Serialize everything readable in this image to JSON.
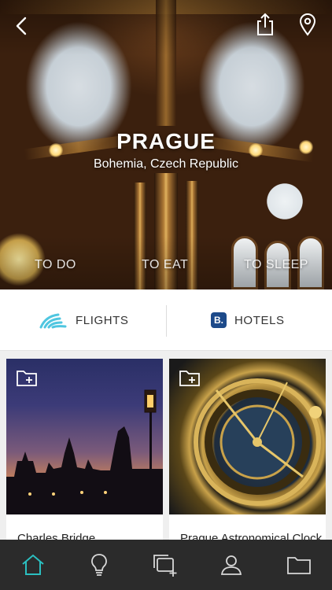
{
  "hero": {
    "title": "PRAGUE",
    "subtitle": "Bohemia, Czech Republic",
    "tabs": [
      {
        "label": "TO DO"
      },
      {
        "label": "TO EAT"
      },
      {
        "label": "TO SLEEP"
      }
    ]
  },
  "topbar": {
    "back_icon": "chevron-left-icon",
    "share_icon": "share-icon",
    "location_icon": "map-pin-icon"
  },
  "booking": {
    "flights_label": "FLIGHTS",
    "hotels_label": "HOTELS",
    "hotels_badge": "B."
  },
  "cards": [
    {
      "caption": "Charles Bridge",
      "icon": "folder-add-icon"
    },
    {
      "caption": "Prague Astronomical Clock",
      "icon": "folder-add-icon"
    }
  ],
  "tabbar": {
    "items": [
      {
        "icon": "home-icon",
        "active": true
      },
      {
        "icon": "lightbulb-icon",
        "active": false
      },
      {
        "icon": "add-collection-icon",
        "active": false
      },
      {
        "icon": "profile-icon",
        "active": false
      },
      {
        "icon": "folder-icon",
        "active": false
      }
    ],
    "active_color": "#2bbfc0",
    "inactive_color": "#d8d8d8"
  }
}
